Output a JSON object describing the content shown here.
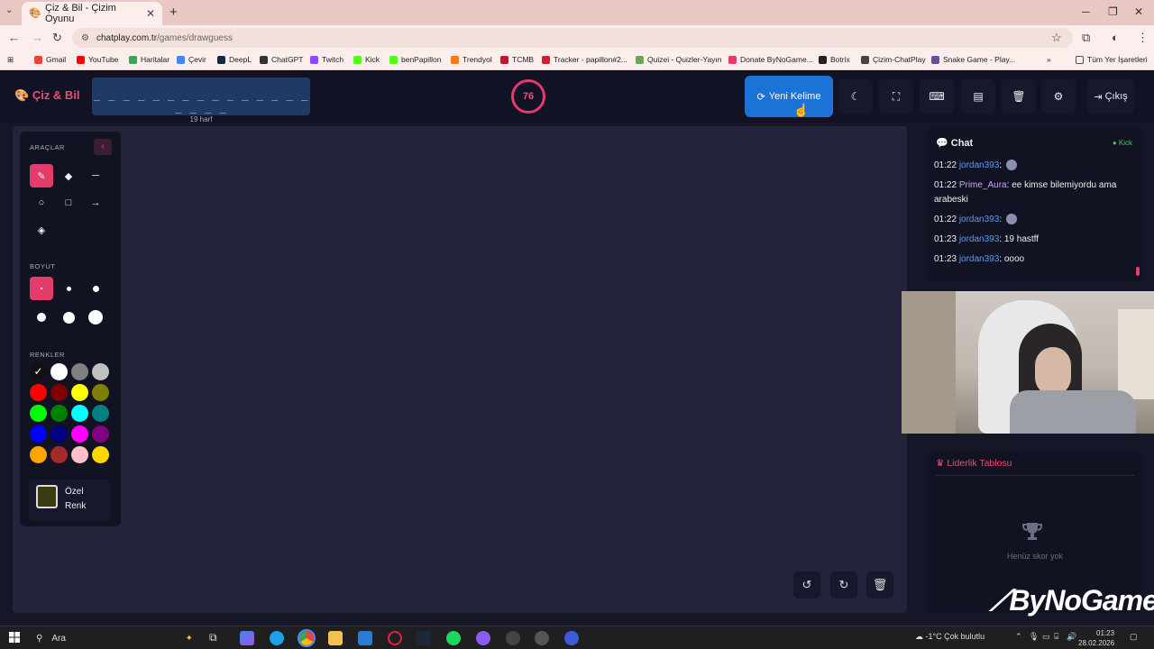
{
  "browser": {
    "tab_title": "Çiz & Bil - Çizim Oyunu",
    "url_prefix": "chatplay.com.tr",
    "url_path": "/games/drawguess",
    "bookmarks": [
      {
        "label": "Gmail",
        "color": "#ea4335"
      },
      {
        "label": "YouTube",
        "color": "#ff0000"
      },
      {
        "label": "Haritalar",
        "color": "#34a853"
      },
      {
        "label": "Çevir",
        "color": "#4285f4"
      },
      {
        "label": "DeepL",
        "color": "#0f2b46"
      },
      {
        "label": "ChatGPT",
        "color": "#333333"
      },
      {
        "label": "Twitch",
        "color": "#9146ff"
      },
      {
        "label": "Kick",
        "color": "#53fc18"
      },
      {
        "label": "benPapillon",
        "color": "#53fc18"
      },
      {
        "label": "Trendyol",
        "color": "#f27a1a"
      },
      {
        "label": "TCMB",
        "color": "#c8102e"
      },
      {
        "label": "Tracker - papillon#2...",
        "color": "#d01f2f"
      },
      {
        "label": "Quizei - Quizler-Yayın",
        "color": "#6aa84f"
      },
      {
        "label": "Donate ByNoGame...",
        "color": "#e33c6b"
      },
      {
        "label": "Botrix",
        "color": "#222222"
      },
      {
        "label": "Çizim-ChatPlay",
        "color": "#444444"
      },
      {
        "label": "Snake Game - Play...",
        "color": "#6d4c9f"
      }
    ],
    "all_bookmarks": "Tüm Yer İşaretleri"
  },
  "header": {
    "logo": "Çiz & Bil",
    "word_dashes": "_ _ _ _ _ _ _ _ _ _ _ _ _ _ _ _ _ _ _",
    "word_hint": "19 harf",
    "timer": "76",
    "new_word": "Yeni Kelime",
    "exit": "Çıkış"
  },
  "tools": {
    "section_tools": "ARAÇLAR",
    "section_size": "BOYUT",
    "section_colors": "RENKLER",
    "custom_color_line1": "Özel",
    "custom_color_line2": "Renk",
    "custom_color_value": "#3c3c14",
    "colors": [
      "#111111",
      "#ffffff",
      "#808080",
      "#c0c0c0",
      "#ff0000",
      "#800000",
      "#ffff00",
      "#808000",
      "#00ff00",
      "#008000",
      "#00ffff",
      "#008080",
      "#0000ff",
      "#000080",
      "#ff00ff",
      "#800080",
      "#ffa500",
      "#a52a2a",
      "#ffc0cb",
      "#ffd700"
    ]
  },
  "chat": {
    "title": "Chat",
    "platform": "Kick",
    "messages": [
      {
        "time": "01:22",
        "user": "jordan393",
        "text": "",
        "emote": true
      },
      {
        "time": "01:22",
        "user": "Prime_Aura",
        "text": "ee kimse bilemiyordu ama arabeski"
      },
      {
        "time": "01:22",
        "user": "jordan393",
        "text": "",
        "emote": true
      },
      {
        "time": "01:23",
        "user": "jordan393",
        "text": "19 hastff"
      },
      {
        "time": "01:23",
        "user": "jordan393",
        "text": "oooo"
      }
    ]
  },
  "leaderboard": {
    "title": "Liderlik Tablosu",
    "empty": "Henüz skor yok"
  },
  "watermark": "ByNoGame",
  "taskbar": {
    "search": "Ara",
    "weather": "-1°C  Çok bulutlu",
    "time": "01:23",
    "date": "28.02.2026"
  }
}
